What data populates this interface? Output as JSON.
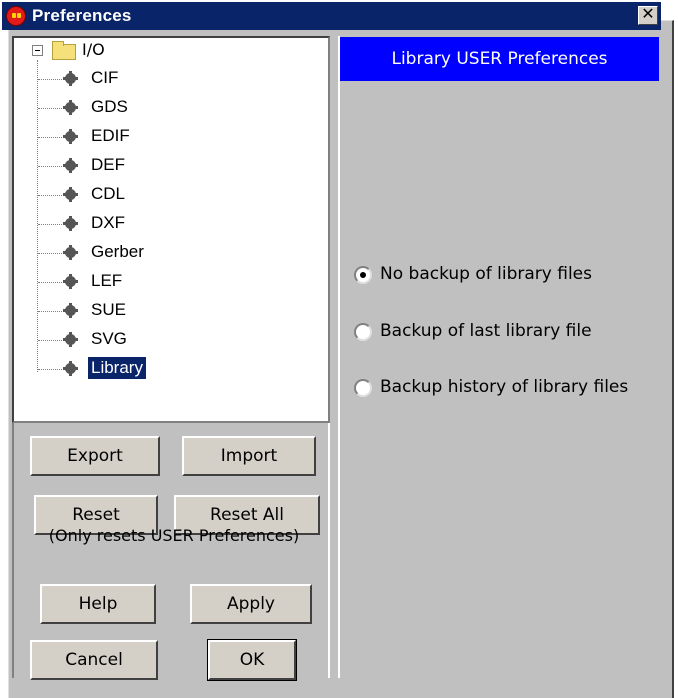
{
  "window": {
    "title": "Preferences",
    "close_label": "✕"
  },
  "tree": {
    "root_label": "I/O",
    "items": [
      {
        "label": "CIF",
        "selected": false
      },
      {
        "label": "GDS",
        "selected": false
      },
      {
        "label": "EDIF",
        "selected": false
      },
      {
        "label": "DEF",
        "selected": false
      },
      {
        "label": "CDL",
        "selected": false
      },
      {
        "label": "DXF",
        "selected": false
      },
      {
        "label": "Gerber",
        "selected": false
      },
      {
        "label": "LEF",
        "selected": false
      },
      {
        "label": "SUE",
        "selected": false
      },
      {
        "label": "SVG",
        "selected": false
      },
      {
        "label": "Library",
        "selected": true
      }
    ]
  },
  "buttons": {
    "export": "Export",
    "import": "Import",
    "reset": "Reset",
    "reset_all": "Reset All",
    "reset_note": "(Only resets USER Preferences)",
    "help": "Help",
    "apply": "Apply",
    "cancel": "Cancel",
    "ok": "OK"
  },
  "panel": {
    "header": "Library USER Preferences",
    "options": [
      {
        "label": "No backup of library files",
        "checked": true
      },
      {
        "label": "Backup of last library file",
        "checked": false
      },
      {
        "label": "Backup history of library files",
        "checked": false
      }
    ]
  },
  "colors": {
    "title_bar": "#0a246a",
    "header_bar": "#0000ff",
    "selection": "#0a246a",
    "dialog_bg": "#c0c0c0"
  }
}
